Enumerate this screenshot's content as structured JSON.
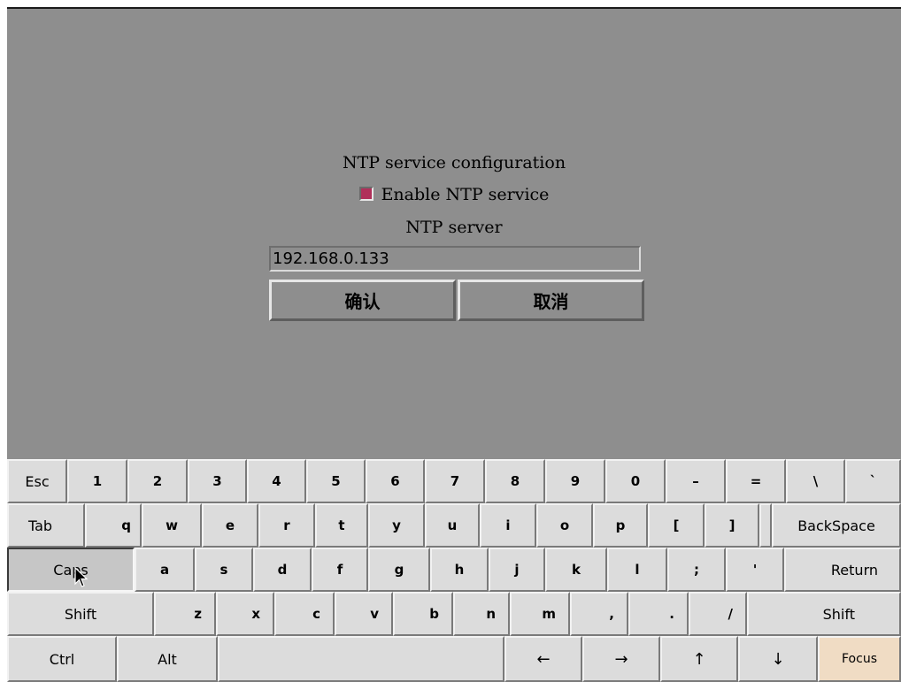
{
  "dialog": {
    "title": "NTP service configuration",
    "enable_label": "Enable NTP service",
    "enable_checked": true,
    "server_label": "NTP server",
    "server_value": "192.168.0.133",
    "ok_label": "确认",
    "cancel_label": "取消"
  },
  "keyboard": {
    "row1": [
      "Esc",
      "1",
      "2",
      "3",
      "4",
      "5",
      "6",
      "7",
      "8",
      "9",
      "0",
      "–",
      "=",
      "\\",
      "`"
    ],
    "row2": [
      "Tab",
      "q",
      "w",
      "e",
      "r",
      "t",
      "y",
      "u",
      "i",
      "o",
      "p",
      "[",
      "]",
      "BackSpace"
    ],
    "row3": [
      "Caps",
      "a",
      "s",
      "d",
      "f",
      "g",
      "h",
      "j",
      "k",
      "l",
      ";",
      "'",
      "Return"
    ],
    "row4": [
      "Shift",
      "z",
      "x",
      "c",
      "v",
      "b",
      "n",
      "m",
      ",",
      ".",
      "/",
      "Shift"
    ],
    "row5": [
      "Ctrl",
      "Alt",
      "",
      "←",
      "→",
      "↑",
      "↓",
      "Focus"
    ],
    "pressed_key": "Caps",
    "focus_color": "#f0dcc4"
  },
  "colors": {
    "desktop": "#8e8e8e",
    "checkbox": "#b0305a",
    "key_face": "#dcdcdc"
  }
}
